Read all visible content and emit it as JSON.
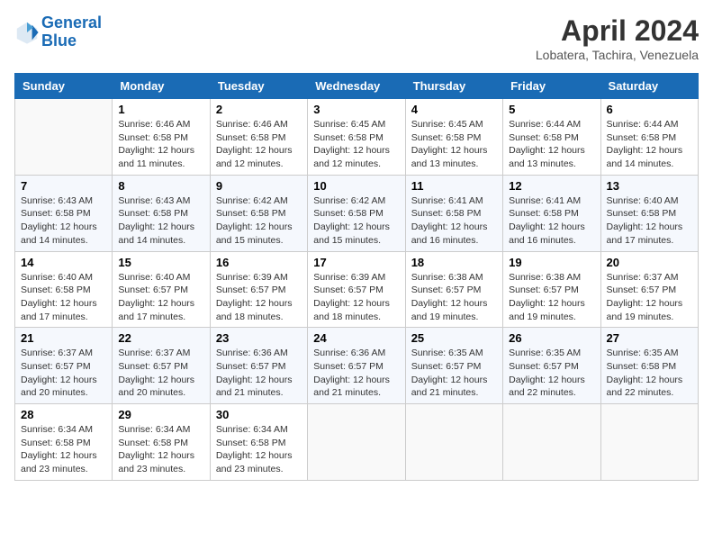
{
  "header": {
    "logo_line1": "General",
    "logo_line2": "Blue",
    "title": "April 2024",
    "location": "Lobatera, Tachira, Venezuela"
  },
  "weekdays": [
    "Sunday",
    "Monday",
    "Tuesday",
    "Wednesday",
    "Thursday",
    "Friday",
    "Saturday"
  ],
  "weeks": [
    [
      {
        "day": "",
        "sunrise": "",
        "sunset": "",
        "daylight": ""
      },
      {
        "day": "1",
        "sunrise": "Sunrise: 6:46 AM",
        "sunset": "Sunset: 6:58 PM",
        "daylight": "Daylight: 12 hours and 11 minutes."
      },
      {
        "day": "2",
        "sunrise": "Sunrise: 6:46 AM",
        "sunset": "Sunset: 6:58 PM",
        "daylight": "Daylight: 12 hours and 12 minutes."
      },
      {
        "day": "3",
        "sunrise": "Sunrise: 6:45 AM",
        "sunset": "Sunset: 6:58 PM",
        "daylight": "Daylight: 12 hours and 12 minutes."
      },
      {
        "day": "4",
        "sunrise": "Sunrise: 6:45 AM",
        "sunset": "Sunset: 6:58 PM",
        "daylight": "Daylight: 12 hours and 13 minutes."
      },
      {
        "day": "5",
        "sunrise": "Sunrise: 6:44 AM",
        "sunset": "Sunset: 6:58 PM",
        "daylight": "Daylight: 12 hours and 13 minutes."
      },
      {
        "day": "6",
        "sunrise": "Sunrise: 6:44 AM",
        "sunset": "Sunset: 6:58 PM",
        "daylight": "Daylight: 12 hours and 14 minutes."
      }
    ],
    [
      {
        "day": "7",
        "sunrise": "Sunrise: 6:43 AM",
        "sunset": "Sunset: 6:58 PM",
        "daylight": "Daylight: 12 hours and 14 minutes."
      },
      {
        "day": "8",
        "sunrise": "Sunrise: 6:43 AM",
        "sunset": "Sunset: 6:58 PM",
        "daylight": "Daylight: 12 hours and 14 minutes."
      },
      {
        "day": "9",
        "sunrise": "Sunrise: 6:42 AM",
        "sunset": "Sunset: 6:58 PM",
        "daylight": "Daylight: 12 hours and 15 minutes."
      },
      {
        "day": "10",
        "sunrise": "Sunrise: 6:42 AM",
        "sunset": "Sunset: 6:58 PM",
        "daylight": "Daylight: 12 hours and 15 minutes."
      },
      {
        "day": "11",
        "sunrise": "Sunrise: 6:41 AM",
        "sunset": "Sunset: 6:58 PM",
        "daylight": "Daylight: 12 hours and 16 minutes."
      },
      {
        "day": "12",
        "sunrise": "Sunrise: 6:41 AM",
        "sunset": "Sunset: 6:58 PM",
        "daylight": "Daylight: 12 hours and 16 minutes."
      },
      {
        "day": "13",
        "sunrise": "Sunrise: 6:40 AM",
        "sunset": "Sunset: 6:58 PM",
        "daylight": "Daylight: 12 hours and 17 minutes."
      }
    ],
    [
      {
        "day": "14",
        "sunrise": "Sunrise: 6:40 AM",
        "sunset": "Sunset: 6:58 PM",
        "daylight": "Daylight: 12 hours and 17 minutes."
      },
      {
        "day": "15",
        "sunrise": "Sunrise: 6:40 AM",
        "sunset": "Sunset: 6:57 PM",
        "daylight": "Daylight: 12 hours and 17 minutes."
      },
      {
        "day": "16",
        "sunrise": "Sunrise: 6:39 AM",
        "sunset": "Sunset: 6:57 PM",
        "daylight": "Daylight: 12 hours and 18 minutes."
      },
      {
        "day": "17",
        "sunrise": "Sunrise: 6:39 AM",
        "sunset": "Sunset: 6:57 PM",
        "daylight": "Daylight: 12 hours and 18 minutes."
      },
      {
        "day": "18",
        "sunrise": "Sunrise: 6:38 AM",
        "sunset": "Sunset: 6:57 PM",
        "daylight": "Daylight: 12 hours and 19 minutes."
      },
      {
        "day": "19",
        "sunrise": "Sunrise: 6:38 AM",
        "sunset": "Sunset: 6:57 PM",
        "daylight": "Daylight: 12 hours and 19 minutes."
      },
      {
        "day": "20",
        "sunrise": "Sunrise: 6:37 AM",
        "sunset": "Sunset: 6:57 PM",
        "daylight": "Daylight: 12 hours and 19 minutes."
      }
    ],
    [
      {
        "day": "21",
        "sunrise": "Sunrise: 6:37 AM",
        "sunset": "Sunset: 6:57 PM",
        "daylight": "Daylight: 12 hours and 20 minutes."
      },
      {
        "day": "22",
        "sunrise": "Sunrise: 6:37 AM",
        "sunset": "Sunset: 6:57 PM",
        "daylight": "Daylight: 12 hours and 20 minutes."
      },
      {
        "day": "23",
        "sunrise": "Sunrise: 6:36 AM",
        "sunset": "Sunset: 6:57 PM",
        "daylight": "Daylight: 12 hours and 21 minutes."
      },
      {
        "day": "24",
        "sunrise": "Sunrise: 6:36 AM",
        "sunset": "Sunset: 6:57 PM",
        "daylight": "Daylight: 12 hours and 21 minutes."
      },
      {
        "day": "25",
        "sunrise": "Sunrise: 6:35 AM",
        "sunset": "Sunset: 6:57 PM",
        "daylight": "Daylight: 12 hours and 21 minutes."
      },
      {
        "day": "26",
        "sunrise": "Sunrise: 6:35 AM",
        "sunset": "Sunset: 6:57 PM",
        "daylight": "Daylight: 12 hours and 22 minutes."
      },
      {
        "day": "27",
        "sunrise": "Sunrise: 6:35 AM",
        "sunset": "Sunset: 6:58 PM",
        "daylight": "Daylight: 12 hours and 22 minutes."
      }
    ],
    [
      {
        "day": "28",
        "sunrise": "Sunrise: 6:34 AM",
        "sunset": "Sunset: 6:58 PM",
        "daylight": "Daylight: 12 hours and 23 minutes."
      },
      {
        "day": "29",
        "sunrise": "Sunrise: 6:34 AM",
        "sunset": "Sunset: 6:58 PM",
        "daylight": "Daylight: 12 hours and 23 minutes."
      },
      {
        "day": "30",
        "sunrise": "Sunrise: 6:34 AM",
        "sunset": "Sunset: 6:58 PM",
        "daylight": "Daylight: 12 hours and 23 minutes."
      },
      {
        "day": "",
        "sunrise": "",
        "sunset": "",
        "daylight": ""
      },
      {
        "day": "",
        "sunrise": "",
        "sunset": "",
        "daylight": ""
      },
      {
        "day": "",
        "sunrise": "",
        "sunset": "",
        "daylight": ""
      },
      {
        "day": "",
        "sunrise": "",
        "sunset": "",
        "daylight": ""
      }
    ]
  ]
}
